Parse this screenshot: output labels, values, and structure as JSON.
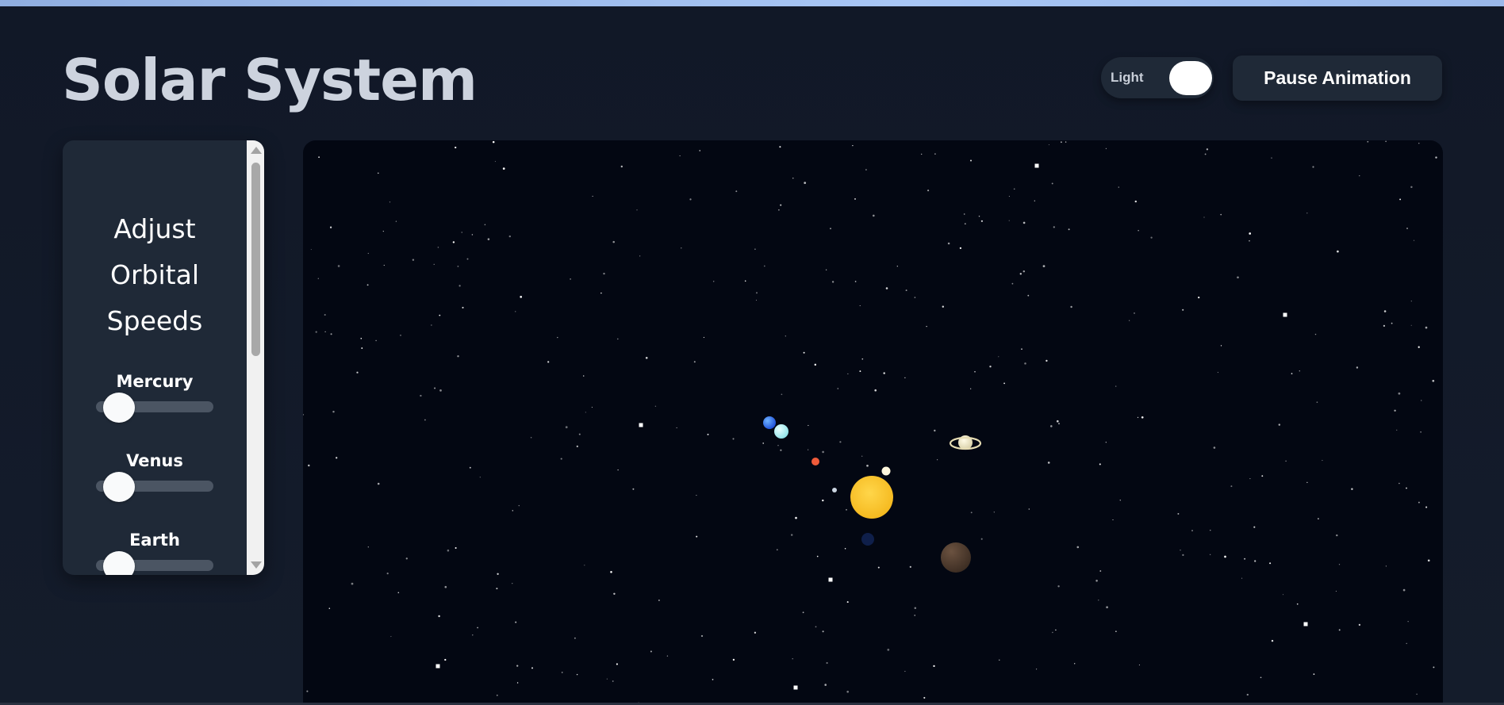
{
  "header": {
    "title": "Solar System",
    "theme_toggle_label": "Light",
    "pause_button_label": "Pause Animation"
  },
  "controls": {
    "heading": "Adjust Orbital Speeds",
    "planets": [
      {
        "label": "Mercury",
        "speed": 0
      },
      {
        "label": "Venus",
        "speed": 0
      },
      {
        "label": "Earth",
        "speed": 0
      }
    ]
  },
  "colors": {
    "background": "#111827",
    "panel": "#1f2937",
    "space": "#030712",
    "sun": "#fcc530"
  },
  "icons": {
    "scroll_up": "triangle-up-icon",
    "scroll_down": "triangle-down-icon"
  }
}
